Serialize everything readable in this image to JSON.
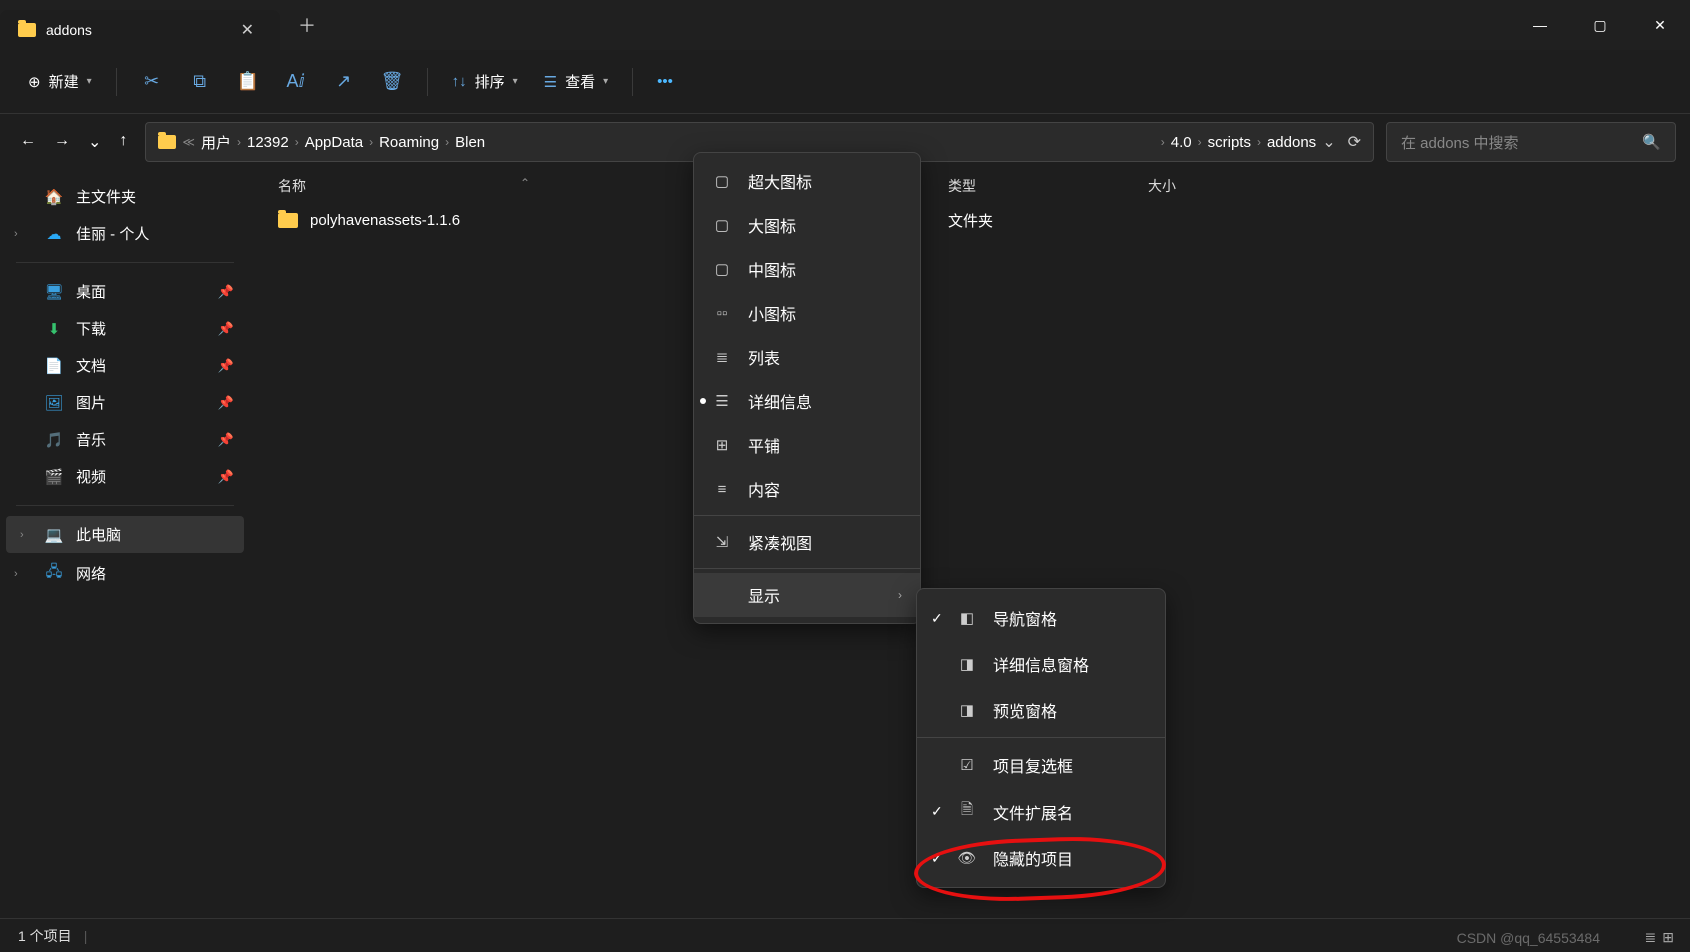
{
  "tab": {
    "title": "addons"
  },
  "toolbar": {
    "new_label": "新建",
    "sort_label": "排序",
    "view_label": "查看"
  },
  "breadcrumb": {
    "items": [
      "用户",
      "12392",
      "AppData",
      "Roaming",
      "Blen",
      "4.0",
      "scripts",
      "addons"
    ]
  },
  "search": {
    "placeholder": "在 addons 中搜索"
  },
  "sidebar": {
    "home": "主文件夹",
    "personal": "佳丽 - 个人",
    "desktop": "桌面",
    "downloads": "下载",
    "documents": "文档",
    "pictures": "图片",
    "music": "音乐",
    "videos": "视频",
    "thispc": "此电脑",
    "network": "网络"
  },
  "columns": {
    "name": "名称",
    "type": "类型",
    "size": "大小"
  },
  "rows": [
    {
      "name": "polyhavenassets-1.1.6",
      "type": "文件夹"
    }
  ],
  "view_menu": {
    "xl_icons": "超大图标",
    "l_icons": "大图标",
    "m_icons": "中图标",
    "s_icons": "小图标",
    "list": "列表",
    "details": "详细信息",
    "tiles": "平铺",
    "content": "内容",
    "compact": "紧凑视图",
    "show": "显示"
  },
  "show_menu": {
    "nav_pane": "导航窗格",
    "details_pane": "详细信息窗格",
    "preview_pane": "预览窗格",
    "checkboxes": "项目复选框",
    "extensions": "文件扩展名",
    "hidden": "隐藏的项目"
  },
  "status": {
    "count": "1 个项目"
  },
  "watermark": "CSDN @qq_64553484"
}
